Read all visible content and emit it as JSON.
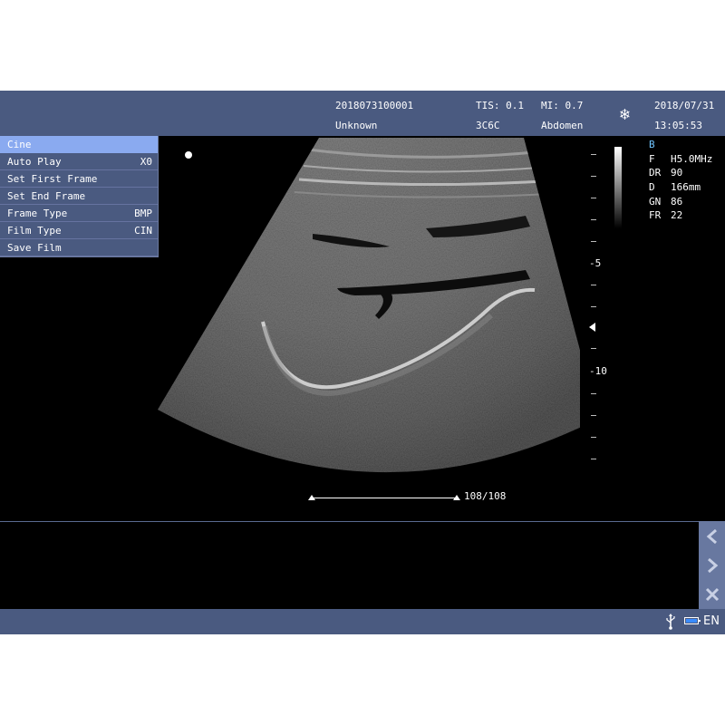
{
  "header": {
    "patient_id": "2018073100001",
    "patient_name": "Unknown",
    "tis": "TIS: 0.1",
    "probe": "3C6C",
    "mi": "MI: 0.7",
    "exam": "Abdomen",
    "date": "2018/07/31",
    "time": "13:05:53",
    "freeze_icon": "snowflake-icon"
  },
  "cine_menu": {
    "title": "Cine",
    "items": [
      {
        "label": "Auto Play",
        "value": "X0"
      },
      {
        "label": "Set First Frame",
        "value": ""
      },
      {
        "label": "Set End Frame",
        "value": ""
      },
      {
        "label": "Frame Type",
        "value": "BMP"
      },
      {
        "label": "Film Type",
        "value": "CIN"
      },
      {
        "label": "Save Film",
        "value": ""
      }
    ]
  },
  "depth_scale": {
    "label_5": "-5",
    "label_10": "-10"
  },
  "params": {
    "mode": "B",
    "items": [
      {
        "key": "F",
        "value": "H5.0MHz"
      },
      {
        "key": "DR",
        "value": "90"
      },
      {
        "key": "D",
        "value": "166mm"
      },
      {
        "key": "GN",
        "value": "86"
      },
      {
        "key": "FR",
        "value": "22"
      }
    ]
  },
  "cine_progress": {
    "current_frame": 108,
    "total_frames": 108,
    "label": "108/108"
  },
  "side_nav": {
    "prev_icon": "chevron-left-icon",
    "next_icon": "chevron-right-icon",
    "close_icon": "close-icon"
  },
  "status_bar": {
    "language": "EN",
    "usb_icon": "usb-icon",
    "battery_icon": "battery-icon"
  },
  "colors": {
    "bar": "#4a5a80",
    "selected": "#8aaaf0",
    "mode": "#6fc4ff"
  }
}
